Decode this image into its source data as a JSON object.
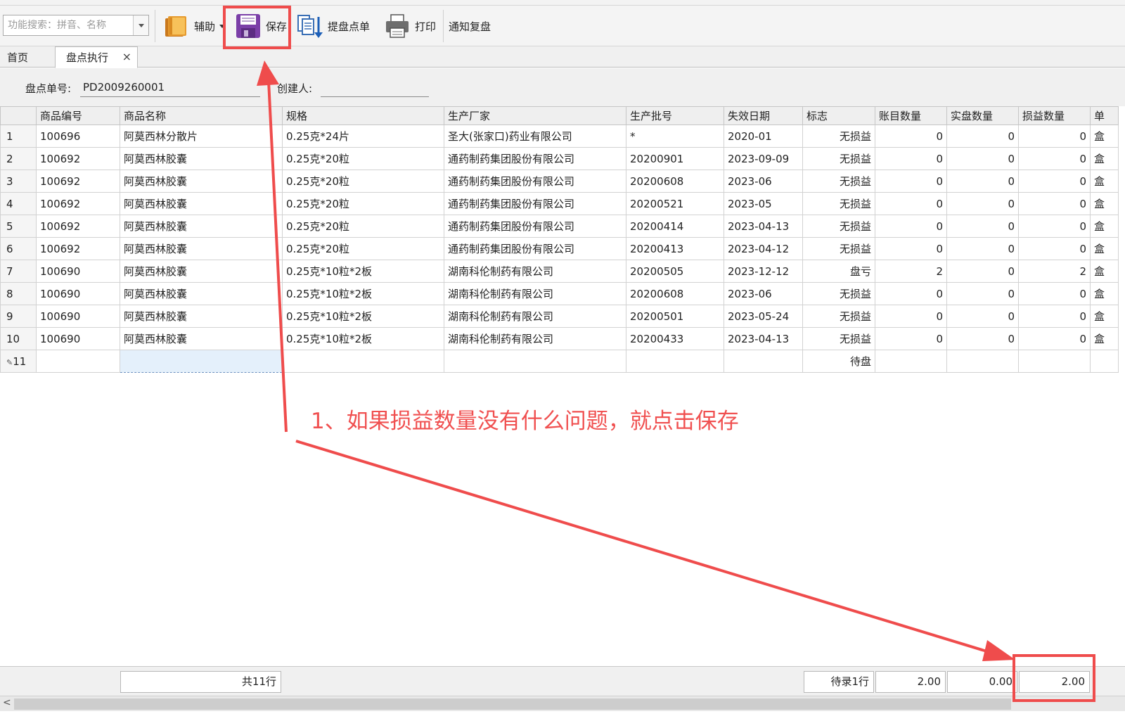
{
  "toolbar": {
    "search_placeholder": "功能搜索：拼音、名称",
    "assist_label": "辅助",
    "save_label": "保存",
    "extract_label": "提盘点单",
    "print_label": "打印",
    "notify_label": "通知复盘"
  },
  "tabs": {
    "home": "首页",
    "active": "盘点执行",
    "close": "×"
  },
  "form": {
    "order_label": "盘点单号:",
    "order_value": "PD2009260001",
    "creator_label": "创建人:",
    "creator_value": ""
  },
  "grid": {
    "columns": [
      "",
      "商品编号",
      "商品名称",
      "规格",
      "生产厂家",
      "生产批号",
      "失效日期",
      "标志",
      "账目数量",
      "实盘数量",
      "损益数量",
      "单"
    ],
    "rows": [
      {
        "no": "1",
        "code": "100696",
        "name": "阿莫西林分散片",
        "spec": "0.25克*24片",
        "maker": "圣大(张家口)药业有限公司",
        "batch": "*",
        "expiry": "2020-01",
        "flag": "无损益",
        "book": "0",
        "actual": "0",
        "diff": "0",
        "unit": "盒"
      },
      {
        "no": "2",
        "code": "100692",
        "name": "阿莫西林胶囊",
        "spec": "0.25克*20粒",
        "maker": "通药制药集团股份有限公司",
        "batch": "20200901",
        "expiry": "2023-09-09",
        "flag": "无损益",
        "book": "0",
        "actual": "0",
        "diff": "0",
        "unit": "盒"
      },
      {
        "no": "3",
        "code": "100692",
        "name": "阿莫西林胶囊",
        "spec": "0.25克*20粒",
        "maker": "通药制药集团股份有限公司",
        "batch": "20200608",
        "expiry": "2023-06",
        "flag": "无损益",
        "book": "0",
        "actual": "0",
        "diff": "0",
        "unit": "盒"
      },
      {
        "no": "4",
        "code": "100692",
        "name": "阿莫西林胶囊",
        "spec": "0.25克*20粒",
        "maker": "通药制药集团股份有限公司",
        "batch": "20200521",
        "expiry": "2023-05",
        "flag": "无损益",
        "book": "0",
        "actual": "0",
        "diff": "0",
        "unit": "盒"
      },
      {
        "no": "5",
        "code": "100692",
        "name": "阿莫西林胶囊",
        "spec": "0.25克*20粒",
        "maker": "通药制药集团股份有限公司",
        "batch": "20200414",
        "expiry": "2023-04-13",
        "flag": "无损益",
        "book": "0",
        "actual": "0",
        "diff": "0",
        "unit": "盒"
      },
      {
        "no": "6",
        "code": "100692",
        "name": "阿莫西林胶囊",
        "spec": "0.25克*20粒",
        "maker": "通药制药集团股份有限公司",
        "batch": "20200413",
        "expiry": "2023-04-12",
        "flag": "无损益",
        "book": "0",
        "actual": "0",
        "diff": "0",
        "unit": "盒"
      },
      {
        "no": "7",
        "code": "100690",
        "name": "阿莫西林胶囊",
        "spec": "0.25克*10粒*2板",
        "maker": "湖南科伦制药有限公司",
        "batch": "20200505",
        "expiry": "2023-12-12",
        "flag": "盘亏",
        "book": "2",
        "actual": "0",
        "diff": "2",
        "unit": "盒"
      },
      {
        "no": "8",
        "code": "100690",
        "name": "阿莫西林胶囊",
        "spec": "0.25克*10粒*2板",
        "maker": "湖南科伦制药有限公司",
        "batch": "20200608",
        "expiry": "2023-06",
        "flag": "无损益",
        "book": "0",
        "actual": "0",
        "diff": "0",
        "unit": "盒"
      },
      {
        "no": "9",
        "code": "100690",
        "name": "阿莫西林胶囊",
        "spec": "0.25克*10粒*2板",
        "maker": "湖南科伦制药有限公司",
        "batch": "20200501",
        "expiry": "2023-05-24",
        "flag": "无损益",
        "book": "0",
        "actual": "0",
        "diff": "0",
        "unit": "盒"
      },
      {
        "no": "10",
        "code": "100690",
        "name": "阿莫西林胶囊",
        "spec": "0.25克*10粒*2板",
        "maker": "湖南科伦制药有限公司",
        "batch": "20200433",
        "expiry": "2023-04-13",
        "flag": "无损益",
        "book": "0",
        "actual": "0",
        "diff": "0",
        "unit": "盒"
      }
    ],
    "new_row": {
      "no": "11",
      "flag": "待盘"
    }
  },
  "footer": {
    "total_rows": "共11行",
    "pending_rows": "待录1行",
    "book_total": "2.00",
    "actual_total": "0.00",
    "diff_total": "2.00"
  },
  "annotation": {
    "text": "1、如果损益数量没有什么问题，就点击保存",
    "color": "#f05050"
  },
  "colors": {
    "flag_none": "#1a1ad6",
    "flag_loss": "#d40000"
  }
}
